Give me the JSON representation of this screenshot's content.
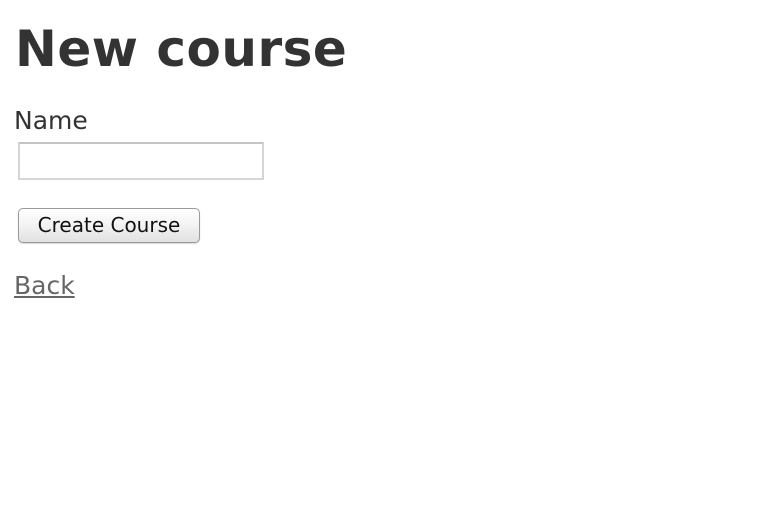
{
  "page": {
    "title": "New course"
  },
  "form": {
    "name_label": "Name",
    "name_value": "",
    "submit_label": "Create Course"
  },
  "nav": {
    "back_label": "Back"
  },
  "colors": {
    "text": "#333333",
    "link": "#666666",
    "input_border": "#d6d6d6",
    "background": "#ffffff"
  }
}
